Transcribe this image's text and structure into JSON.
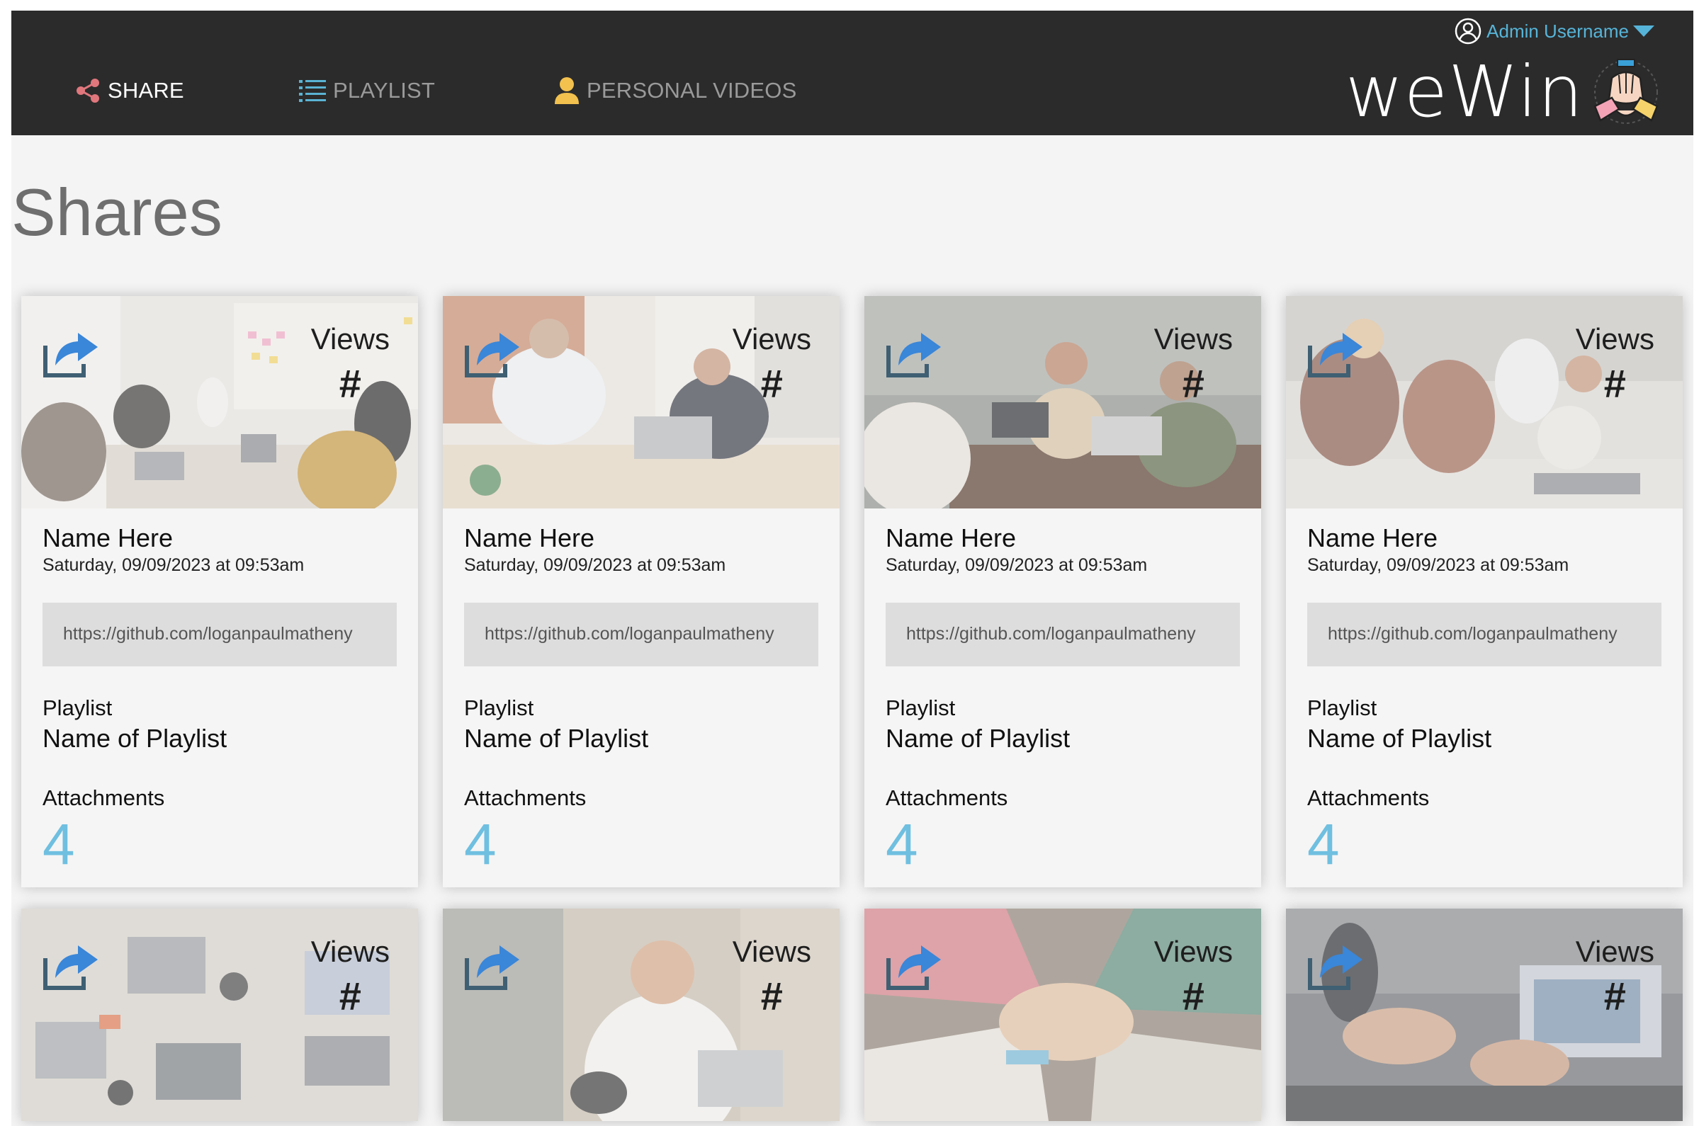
{
  "header": {
    "nav": [
      {
        "label": "SHARE",
        "icon": "share-icon",
        "active": true
      },
      {
        "label": "PLAYLIST",
        "icon": "list-icon",
        "active": false
      },
      {
        "label": "PERSONAL VIDEOS",
        "icon": "person-icon",
        "active": false
      }
    ],
    "user": {
      "label": "Admin Username",
      "icon": "user-circle-icon",
      "caret": "chevron-down-icon"
    },
    "brand": {
      "text": "weWin",
      "logo": "hands-together-logo"
    }
  },
  "page_title": "Shares",
  "colors": {
    "header_bg": "#2b2b2b",
    "accent": "#56b4d8",
    "attachments": "#6fbfe0",
    "page_bg": "#f4f4f4"
  },
  "cards": [
    {
      "views_label": "Views",
      "views_count": "#",
      "name": "Name Here",
      "date": "Saturday, 09/09/2023 at 09:53am",
      "link": "https://github.com/loganpaulmatheny",
      "playlist_label": "Playlist",
      "playlist_name": "Name of Playlist",
      "attachments_label": "Attachments",
      "attachments_count": "4",
      "photo": "team-meeting-whiteboard"
    },
    {
      "views_label": "Views",
      "views_count": "#",
      "name": "Name Here",
      "date": "Saturday, 09/09/2023 at 09:53am",
      "link": "https://github.com/loganpaulmatheny",
      "playlist_label": "Playlist",
      "playlist_name": "Name of Playlist",
      "attachments_label": "Attachments",
      "attachments_count": "4",
      "photo": "coworkers-high-five"
    },
    {
      "views_label": "Views",
      "views_count": "#",
      "name": "Name Here",
      "date": "Saturday, 09/09/2023 at 09:53am",
      "link": "https://github.com/loganpaulmatheny",
      "playlist_label": "Playlist",
      "playlist_name": "Name of Playlist",
      "attachments_label": "Attachments",
      "attachments_count": "4",
      "photo": "friends-laughing-laptops"
    },
    {
      "views_label": "Views",
      "views_count": "#",
      "name": "Name Here",
      "date": "Saturday, 09/09/2023 at 09:53am",
      "link": "https://github.com/loganpaulmatheny",
      "playlist_label": "Playlist",
      "playlist_name": "Name of Playlist",
      "attachments_label": "Attachments",
      "attachments_count": "4",
      "photo": "office-group-desk"
    },
    {
      "views_label": "Views",
      "views_count": "#",
      "photo": "laptops-from-above"
    },
    {
      "views_label": "Views",
      "views_count": "#",
      "photo": "man-on-phone"
    },
    {
      "views_label": "Views",
      "views_count": "#",
      "photo": "stacked-hands"
    },
    {
      "views_label": "Views",
      "views_count": "#",
      "photo": "hands-gesturing-laptop"
    }
  ]
}
